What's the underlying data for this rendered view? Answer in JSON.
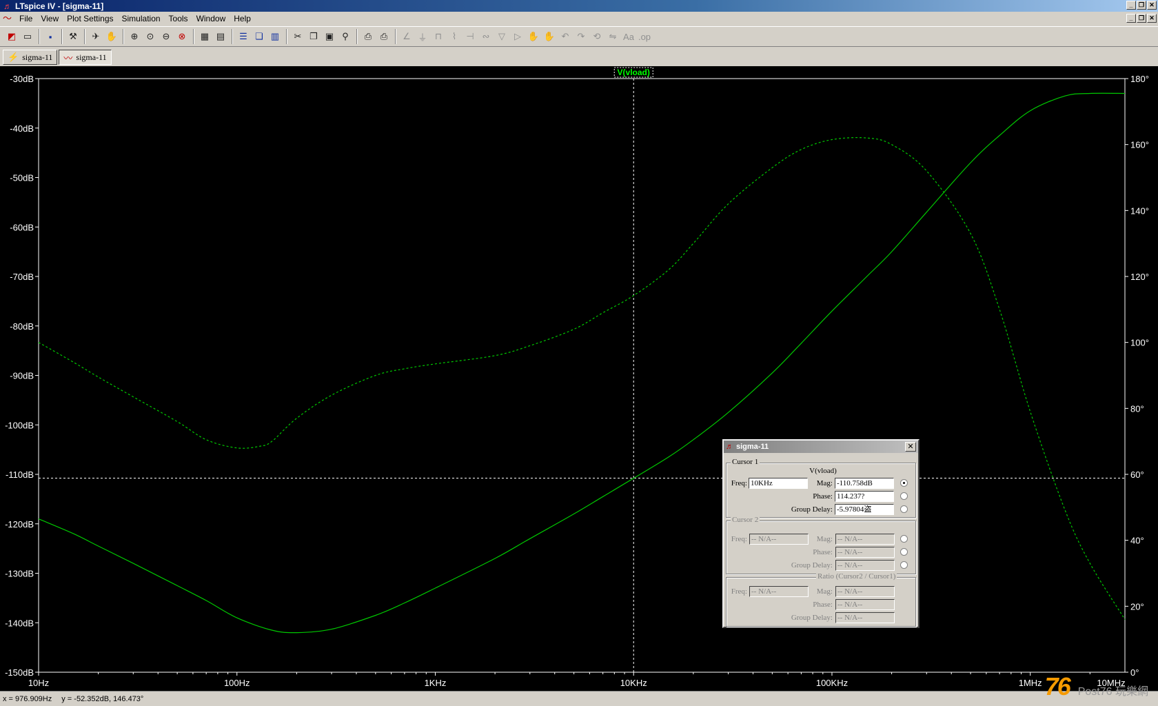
{
  "window": {
    "title": "LTspice IV - [sigma-11]"
  },
  "menu": [
    "File",
    "View",
    "Plot Settings",
    "Simulation",
    "Tools",
    "Window",
    "Help"
  ],
  "tabs": [
    {
      "label": "sigma-11",
      "icon": "schematic-icon",
      "active": false
    },
    {
      "label": "sigma-11",
      "icon": "waveform-icon",
      "active": true
    }
  ],
  "trace_label": "V(vload)",
  "colors": {
    "trace": "#00c800",
    "background": "#000000",
    "axis": "#ffffff",
    "label_text": "#00ff00"
  },
  "chart_data": {
    "type": "line",
    "x_scale": "log",
    "xlim": [
      10,
      3000000
    ],
    "x_tick_labels": [
      "10Hz",
      "100Hz",
      "1KHz",
      "10KHz",
      "100KHz",
      "1MHz",
      "10MHz"
    ],
    "x_tick_values": [
      10,
      100,
      1000,
      10000,
      100000,
      1000000,
      10000000
    ],
    "left_ylim": [
      -150,
      -30
    ],
    "left_tick_labels": [
      "-30dB",
      "-40dB",
      "-50dB",
      "-60dB",
      "-70dB",
      "-80dB",
      "-90dB",
      "-100dB",
      "-110dB",
      "-120dB",
      "-130dB",
      "-140dB",
      "-150dB"
    ],
    "right_ylim": [
      0,
      180
    ],
    "right_tick_labels": [
      "180°",
      "160°",
      "140°",
      "120°",
      "100°",
      "80°",
      "60°",
      "40°",
      "20°",
      "0°"
    ],
    "series": [
      {
        "name": "V(vload)",
        "style": "solid",
        "axis": "left",
        "x": [
          10,
          15,
          20,
          30,
          50,
          70,
          100,
          150,
          200,
          300,
          500,
          700,
          1000,
          2000,
          3000,
          5000,
          7000,
          10000,
          15000,
          20000,
          30000,
          50000,
          70000,
          100000,
          150000,
          200000,
          300000,
          500000,
          700000,
          1000000,
          1500000,
          2000000,
          3000000
        ],
        "y": [
          -119,
          -122,
          -124.5,
          -128,
          -132.5,
          -135.5,
          -139,
          -141.5,
          -142,
          -141.3,
          -138.5,
          -136,
          -133,
          -127,
          -123,
          -118,
          -114.5,
          -110.8,
          -106.5,
          -103,
          -97.5,
          -89.5,
          -83.5,
          -77,
          -70,
          -65,
          -57,
          -47,
          -41.5,
          -36.5,
          -33.5,
          -33,
          -33
        ]
      },
      {
        "name": "V(vload) phase",
        "style": "dashed",
        "axis": "right",
        "x": [
          10,
          15,
          20,
          30,
          50,
          70,
          100,
          130,
          150,
          200,
          300,
          500,
          700,
          1000,
          2000,
          3000,
          5000,
          7000,
          10000,
          15000,
          20000,
          30000,
          50000,
          70000,
          100000,
          150000,
          200000,
          300000,
          500000,
          700000,
          1000000,
          1500000,
          2000000,
          3000000
        ],
        "y": [
          100,
          94,
          89.5,
          83.5,
          76,
          70.5,
          68,
          68.5,
          70,
          77,
          84,
          90,
          92,
          93.5,
          96,
          99,
          104,
          109,
          114.2,
          122,
          130,
          142,
          153,
          158.5,
          161.5,
          162,
          160,
          152,
          133,
          110,
          79,
          49,
          33,
          16
        ]
      }
    ],
    "cursor": {
      "x": 10000,
      "y_db": -110.758
    }
  },
  "status": {
    "x_readout": "x = 976.909Hz",
    "y_readout": "y = -52.352dB, 146.473°"
  },
  "dialog": {
    "title": "sigma-11",
    "close": "✕",
    "cursor1": {
      "group": "Cursor 1",
      "trace": "V(vload)",
      "freq_label": "Freq:",
      "freq": "10KHz",
      "mag_label": "Mag:",
      "mag": "-110.758dB",
      "phase_label": "Phase:",
      "phase": "114.237?",
      "gd_label": "Group Delay:",
      "gd": "-5.97804盗"
    },
    "cursor2": {
      "group": "Cursor 2",
      "freq_label": "Freq:",
      "freq": "-- N/A--",
      "mag_label": "Mag:",
      "mag": "-- N/A--",
      "phase_label": "Phase:",
      "phase": "-- N/A--",
      "gd_label": "Group Delay:",
      "gd": "-- N/A--"
    },
    "ratio": {
      "group": "Ratio (Cursor2 / Cursor1)",
      "freq_label": "Freq:",
      "freq": "-- N/A--",
      "mag_label": "Mag:",
      "mag": "-- N/A--",
      "phase_label": "Phase:",
      "phase": "-- N/A--",
      "gd_label": "Group Delay:",
      "gd": "-- N/A--"
    }
  },
  "watermark": {
    "logo": "76",
    "text": "Post76 玩樂網"
  }
}
